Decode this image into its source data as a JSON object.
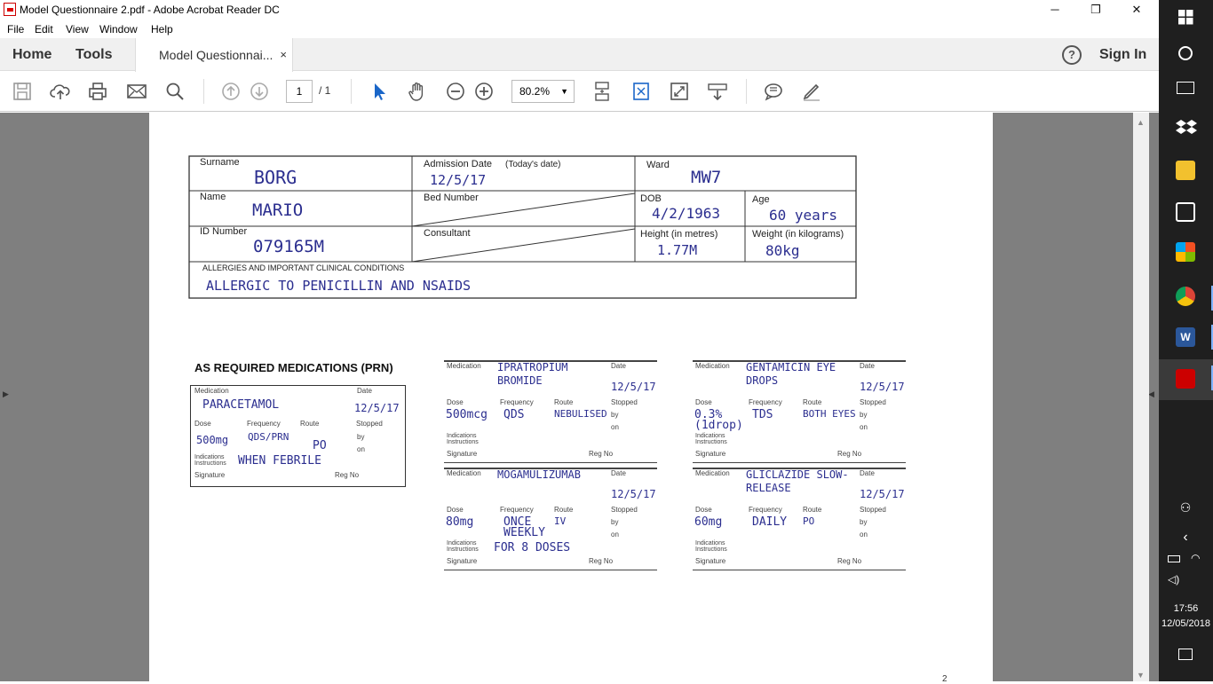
{
  "window": {
    "title": "Model Questionnaire 2.pdf - Adobe Acrobat Reader DC",
    "minimize": "─",
    "maximize": "❐",
    "close": "✕"
  },
  "menu": [
    "File",
    "Edit",
    "View",
    "Window",
    "Help"
  ],
  "tabs": {
    "home": "Home",
    "tools": "Tools",
    "document": "Model Questionnai...",
    "close": "×",
    "help": "?",
    "sign_in": "Sign In"
  },
  "toolbar": {
    "page_current": "1",
    "page_total": "/ 1",
    "zoom": "80.2%",
    "zoom_arrow": "▼"
  },
  "icons": {
    "save": "save-icon",
    "upload": "upload-icon",
    "print": "print-icon",
    "mail": "mail-icon",
    "search": "search-icon",
    "prev": "prev-page-icon",
    "next": "next-page-icon",
    "select": "select-cursor-icon",
    "hand": "hand-icon",
    "zoom_out": "zoom-out-icon",
    "zoom_in": "zoom-in-icon",
    "comment": "comment-icon",
    "pen": "pen-icon"
  },
  "form": {
    "surname_label": "Surname",
    "surname": "BORG",
    "admission_label": "Admission Date",
    "admission_hint": "(Today's date)",
    "admission": "12/5/17",
    "ward_label": "Ward",
    "ward": "MW7",
    "name_label": "Name",
    "name": "MARIO",
    "bed_label": "Bed Number",
    "dob_label": "DOB",
    "dob": "4/2/1963",
    "age_label": "Age",
    "age": "60 years",
    "id_label": "ID Number",
    "id": "079165M",
    "consultant_label": "Consultant",
    "height_label": "Height (in metres)",
    "height": "1.77M",
    "weight_label": "Weight (in kilograms)",
    "weight": "80kg",
    "allergy_label": "ALLERGIES AND IMPORTANT CLINICAL CONDITIONS",
    "allergy": "ALLERGIC TO PENICILLIN AND NSAIDS"
  },
  "prn_heading": "AS REQUIRED MEDICATIONS (PRN)",
  "labels": {
    "medication": "Medication",
    "date": "Date",
    "dose": "Dose",
    "frequency": "Frequency",
    "route": "Route",
    "stopped": "Stopped",
    "by": "by",
    "on": "on",
    "indications": "Indications Instructions",
    "signature": "Signature",
    "reg_no": "Reg No"
  },
  "prn_card": {
    "medication": "PARACETAMOL",
    "date": "12/5/17",
    "dose": "500mg",
    "frequency": "QDS/PRN",
    "route": "PO",
    "indications": "WHEN FEBRILE"
  },
  "med_cards": [
    {
      "medication": "IPRATROPIUM BROMIDE",
      "date": "12/5/17",
      "dose": "500mcg",
      "frequency": "QDS",
      "route": "NEBULISED",
      "indications": ""
    },
    {
      "medication": "GENTAMICIN EYE DROPS",
      "date": "12/5/17",
      "dose": "0.3% (1drop)",
      "frequency": "TDS",
      "route": "BOTH EYES",
      "indications": ""
    },
    {
      "medication": "MOGAMULIZUMAB",
      "date": "12/5/17",
      "dose": "80mg",
      "frequency": "ONCE WEEKLY",
      "route": "IV",
      "indications": "FOR 8 DOSES"
    },
    {
      "medication": "GLICLAZIDE SLOW-RELEASE",
      "date": "12/5/17",
      "dose": "60mg",
      "frequency": "DAILY",
      "route": "PO",
      "indications": ""
    }
  ],
  "page_number": "2",
  "taskbar": {
    "time": "17:56",
    "date": "12/05/2018"
  }
}
